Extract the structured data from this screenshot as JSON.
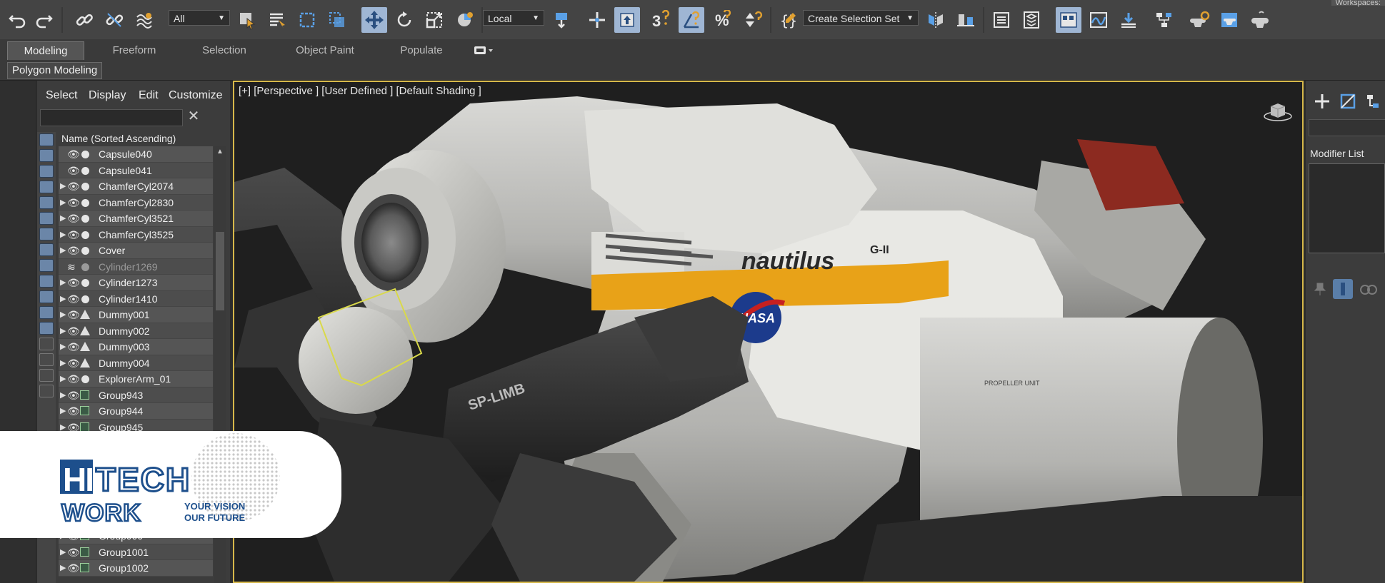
{
  "toolbar": {
    "filter_value": "All",
    "coord_value": "Local",
    "selection_set_value": "Create Selection Set",
    "workspace_label": "Workspaces:"
  },
  "ribbon": {
    "tabs": [
      "Modeling",
      "Freeform",
      "Selection",
      "Object Paint",
      "Populate"
    ],
    "active_tab": "Modeling",
    "subtab": "Polygon Modeling"
  },
  "explorer": {
    "menu": [
      "Select",
      "Display",
      "Edit",
      "Customize"
    ],
    "search_value": "",
    "column_header": "Name (Sorted Ascending)",
    "rows": [
      {
        "label": "Capsule040",
        "icon": "sphere"
      },
      {
        "label": "Capsule041",
        "icon": "sphere"
      },
      {
        "label": "ChamferCyl2074",
        "icon": "sphere"
      },
      {
        "label": "ChamferCyl2830",
        "icon": "sphere"
      },
      {
        "label": "ChamferCyl3521",
        "icon": "sphere"
      },
      {
        "label": "ChamferCyl3525",
        "icon": "sphere"
      },
      {
        "label": "Cover",
        "icon": "sphere"
      },
      {
        "label": "Cylinder1269",
        "icon": "sphere"
      },
      {
        "label": "Cylinder1273",
        "icon": "sphere"
      },
      {
        "label": "Cylinder1410",
        "icon": "sphere"
      },
      {
        "label": "Dummy001",
        "icon": "helper"
      },
      {
        "label": "Dummy002",
        "icon": "helper"
      },
      {
        "label": "Dummy003",
        "icon": "helper"
      },
      {
        "label": "Dummy004",
        "icon": "helper"
      },
      {
        "label": "ExplorerArm_01",
        "icon": "sphere"
      },
      {
        "label": "Group943",
        "icon": "group"
      },
      {
        "label": "Group944",
        "icon": "group"
      },
      {
        "label": "Group945",
        "icon": "group"
      }
    ],
    "bottom_rows": [
      {
        "label": "Group999",
        "icon": "group"
      },
      {
        "label": "Group1001",
        "icon": "group"
      },
      {
        "label": "Group1002",
        "icon": "group"
      }
    ]
  },
  "viewport": {
    "label": "[+] [Perspective ]  [User Defined ]  [Default Shading ]",
    "decal_main": "nautilus",
    "decal_sub": "G-II",
    "decal_nasa": "NASA",
    "decal_unit": "PROPELLER UNIT",
    "arm_label": "SP-LIMB"
  },
  "command_panel": {
    "modifier_list_label": "Modifier List"
  },
  "logo": {
    "hi": "HI",
    "tech": "TECH",
    "work": "WORK",
    "tagline_1": "YOUR VISION",
    "tagline_2": "OUR FUTURE"
  },
  "colors": {
    "accent_selection": "#d6b84a",
    "logo_blue": "#1d4f8c",
    "decal_orange": "#e8a218"
  }
}
